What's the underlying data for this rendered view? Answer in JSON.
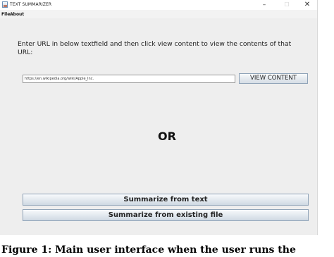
{
  "window": {
    "title": "TEXT SUMMARIZER",
    "minimize_symbol": "–",
    "maximize_symbol": "☐",
    "close_symbol": "✕",
    "app_icon": "java-app-icon"
  },
  "menubar": {
    "items": [
      {
        "label": "File"
      },
      {
        "label": "About"
      }
    ]
  },
  "main": {
    "instruction": "Enter URL in below textfield and then click view content to view the contents of that URL:",
    "url_input_value": "https://en.wikipedia.org/wiki/Apple_Inc.",
    "view_button_label": "VIEW CONTENT",
    "or_label": "OR",
    "summarize_text_label": "Summarize from text",
    "summarize_file_label": "Summarize from existing file"
  },
  "caption": {
    "text": "Figure 1: Main user interface when the user runs the"
  }
}
